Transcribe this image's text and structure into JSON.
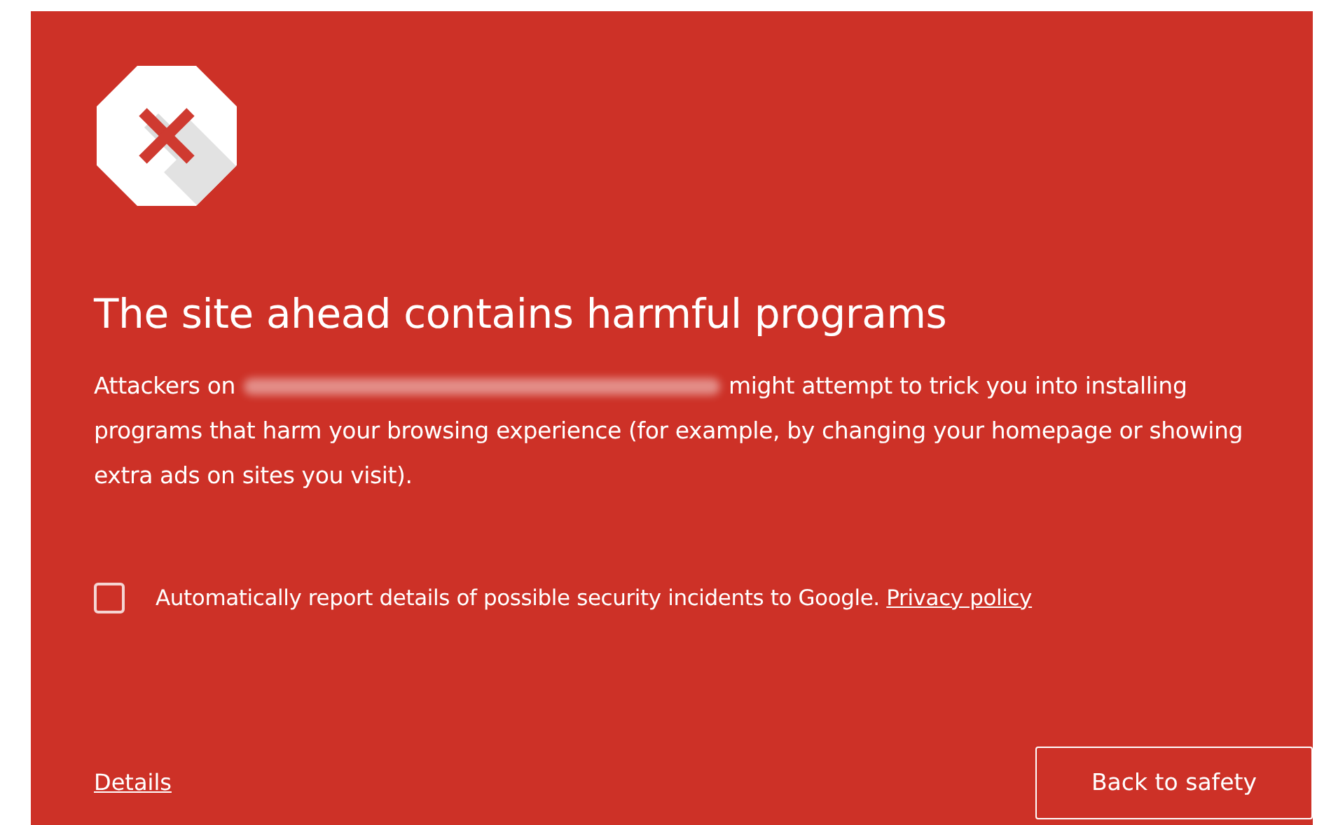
{
  "heading": "The site ahead contains harmful programs",
  "message": {
    "before_url": "Attackers on",
    "after_url": "might attempt to trick you into installing programs that harm your browsing experience (for example, by changing your homepage or showing extra ads on sites you visit)."
  },
  "report_option": {
    "checked": false,
    "label": "Automatically report details of possible security incidents to Google.",
    "link": "Privacy policy"
  },
  "details_link": "Details",
  "primary_button": "Back to safety"
}
